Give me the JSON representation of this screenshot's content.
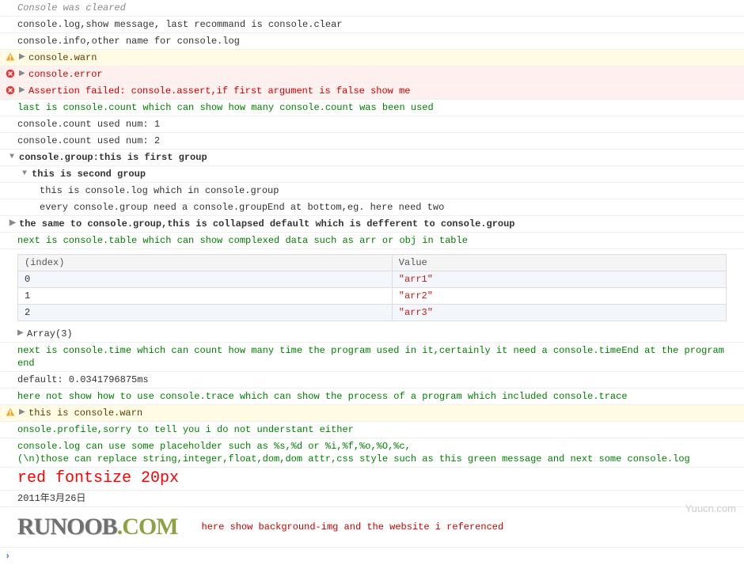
{
  "lines": {
    "cleared": "Console was cleared",
    "log1": "console.log,show message, last recommand is console.clear",
    "info1": "console.info,other name for console.log",
    "warn1": "console.warn",
    "error1": "console.error",
    "assert1": "Assertion failed: console.assert,if first argument is false show me",
    "green1": "last is console.count which can show how many console.count was been used",
    "count1": "console.count used num: 1",
    "count2": "console.count used num: 2",
    "group1": "console.group:this is first group",
    "group2": "this is second group",
    "groupInner1": "this is console.log which in console.group",
    "groupInner2": "every console.group need a console.groupEnd at bottom,eg. here need two",
    "collapsed": "the same to console.group,this is collapsed default which is defferent to console.group",
    "green2": "next is console.table which can show complexed data such as arr or obj in table",
    "arrayLabel": "Array(3)",
    "green3": "next is console.time which can count how many time the program used in it,certainly it need a console.timeEnd at the program end",
    "time1": "default: 0.0341796875ms",
    "green4": "here not show how to use console.trace which can show the process of a program which included console.trace",
    "warn2": "this is console.warn",
    "green5": "onsole.profile,sorry to tell you i do not understant either",
    "placeholder1": "console.log can use some placeholder such as %s,%d or %i,%f,%o,%O,%c,",
    "placeholder2": " (\\n)those can replace string,integer,float,dom,dom attr,css style such as this green message and next some console.log",
    "styledRed": "red fontsize 20px",
    "date": "2011年3月26日",
    "logoText": "here show background-img and the website i referenced"
  },
  "table": {
    "headers": [
      "(index)",
      "Value"
    ],
    "rows": [
      {
        "idx": "0",
        "val": "\"arr1\""
      },
      {
        "idx": "1",
        "val": "\"arr2\""
      },
      {
        "idx": "2",
        "val": "\"arr3\""
      }
    ]
  },
  "logo": {
    "part1": "RUNOOB",
    "part2": ".COM"
  },
  "watermark": "Yuucn.com"
}
